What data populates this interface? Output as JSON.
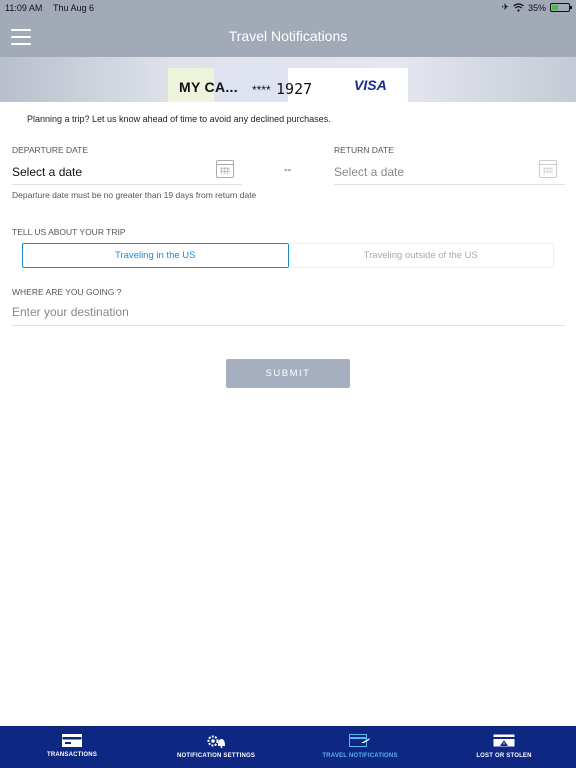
{
  "status_bar": {
    "time": "11:09 AM",
    "date": "Thu Aug 6",
    "battery": "35%",
    "battery_level": 0.35
  },
  "nav": {
    "title": "Travel Notifications"
  },
  "card": {
    "name": "MY CA...",
    "mask": "****",
    "last4": "1927",
    "brand": "VISA"
  },
  "intro": "Planning a trip? Let us know ahead of time to avoid any declined purchases.",
  "departure": {
    "label": "DEPARTURE DATE",
    "value": "Select a date",
    "hint": "Departure date must be no greater than 19 days from return date"
  },
  "separator": "--",
  "return": {
    "label": "RETURN DATE",
    "value": "Select a date"
  },
  "trip": {
    "label": "TELL US ABOUT YOUR TRIP",
    "options": [
      "Traveling in the US",
      "Traveling outside of the US"
    ],
    "selected": "Traveling in the US"
  },
  "destination": {
    "label": "WHERE ARE YOU GOING ?",
    "placeholder": "Enter your destination"
  },
  "submit_label": "SUBMIT",
  "tabs": [
    {
      "label": "TRANSACTIONS",
      "icon": "card-icon"
    },
    {
      "label": "NOTIFICATION SETTINGS",
      "icon": "gear-bell-icon"
    },
    {
      "label": "TRAVEL NOTIFICATIONS",
      "icon": "plane-card-icon"
    },
    {
      "label": "LOST OR STOLEN",
      "icon": "warning-card-icon"
    }
  ],
  "colors": {
    "header": "#a2a9b7",
    "tabbar": "#0e2783",
    "accent": "#1e88d4",
    "active_tab": "#5ab4ee"
  }
}
